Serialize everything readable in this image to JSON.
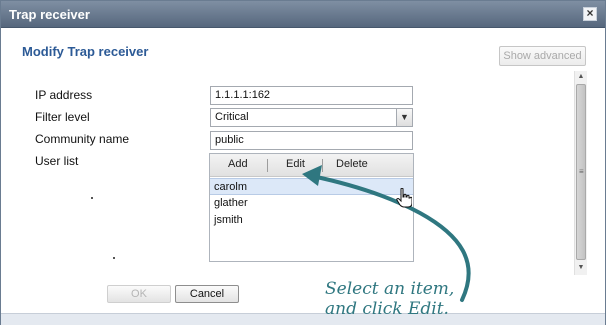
{
  "window": {
    "title": "Trap receiver"
  },
  "subtitle": "Modify Trap receiver",
  "show_advanced_label": "Show advanced",
  "form": {
    "ip_address": {
      "label": "IP address",
      "value": "1.1.1.1:162"
    },
    "filter_level": {
      "label": "Filter level",
      "value": "Critical"
    },
    "community_name": {
      "label": "Community name",
      "value": "public"
    },
    "user_list": {
      "label": "User list",
      "toolbar": {
        "add": "Add",
        "edit": "Edit",
        "delete": "Delete"
      },
      "users": [
        "carolm",
        "glather",
        "jsmith"
      ],
      "selected_index": 0
    }
  },
  "buttons": {
    "ok": "OK",
    "cancel": "Cancel"
  },
  "callout": {
    "line1": "Select an item,",
    "line2": "and click Edit."
  },
  "icons": {
    "close": "close-icon",
    "dropdown": "chevron-down-icon",
    "cursor": "hand-pointer-icon"
  },
  "colors": {
    "title_bar": "#6b7b90",
    "subtitle": "#2c5a96",
    "callout": "#2f7780",
    "selection": "#dce8f8"
  }
}
